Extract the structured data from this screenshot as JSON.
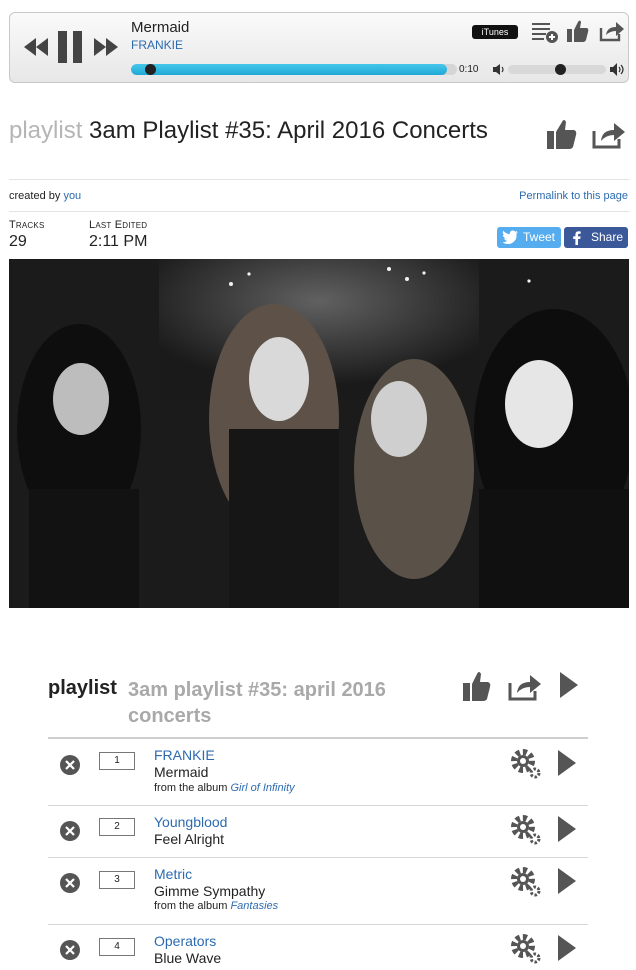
{
  "player": {
    "song": "Mermaid",
    "artist": "FRANKIE",
    "itunes_label": "iTunes",
    "elapsed": "0:10",
    "progress_fraction": 0.97,
    "volume_fraction": 0.55,
    "icons": [
      "previous-icon",
      "pause-icon",
      "next-icon",
      "add-to-queue-icon",
      "thumbs-up-icon",
      "share-icon",
      "volume-low-icon",
      "volume-high-icon"
    ]
  },
  "header": {
    "kind": "playlist",
    "title": "3am Playlist #35: April 2016 Concerts",
    "created_by_prefix": "created by",
    "created_by": "you",
    "permalink": "Permalink to this page"
  },
  "stats": {
    "tracks_label": "Tracks",
    "tracks_value": "29",
    "edited_label": "Last Edited",
    "edited_value": "2:11 PM"
  },
  "social": {
    "tweet_label": "Tweet",
    "share_label": "Share",
    "tweet_color": "#55acee",
    "facebook_color": "#3b5998"
  },
  "playlist_panel": {
    "kind": "playlist",
    "title": "3am playlist #35: april 2016 concerts"
  },
  "tracks": [
    {
      "number": "1",
      "artist": "FRANKIE",
      "song": "Mermaid",
      "album_prefix": "from the album",
      "album": "Girl of Infinity"
    },
    {
      "number": "2",
      "artist": "Youngblood",
      "song": "Feel Alright",
      "album_prefix": "",
      "album": ""
    },
    {
      "number": "3",
      "artist": "Metric",
      "song": "Gimme Sympathy",
      "album_prefix": "from the album",
      "album": "Fantasies"
    },
    {
      "number": "4",
      "artist": "Operators",
      "song": "Blue Wave",
      "album_prefix": "",
      "album": ""
    }
  ],
  "colors": {
    "accent_link": "#2c6bb0",
    "progress": "#26b3e0",
    "muted_title": "#a9a9a9"
  }
}
